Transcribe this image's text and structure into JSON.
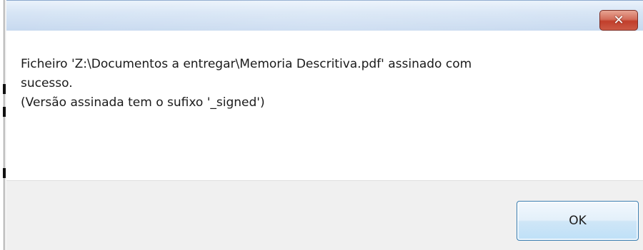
{
  "dialog": {
    "title": "",
    "close_symbol": "✕",
    "message_lines": [
      "Ficheiro 'Z:\\Documentos a entregar\\Memoria Descritiva.pdf' assinado com",
      "sucesso.",
      "(Versão assinada tem o sufixo '_signed')"
    ],
    "ok_label": "OK"
  },
  "colors": {
    "titlebar": "#d7e5f5",
    "close_button": "#c13e2b",
    "footer": "#f0f0f0",
    "ok_border": "#3c7fb1"
  },
  "icons": {
    "close": "close-icon"
  }
}
